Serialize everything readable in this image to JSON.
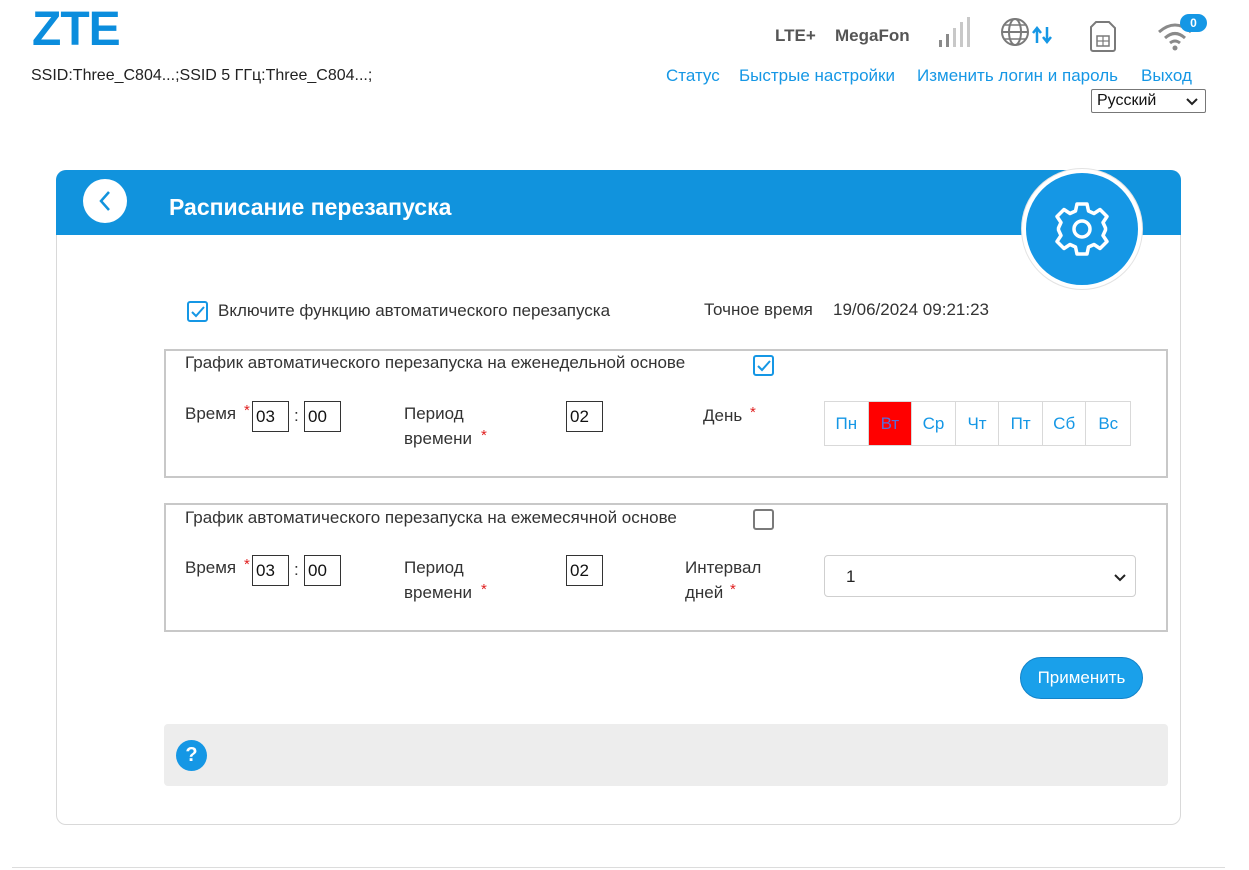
{
  "header": {
    "logo": "ZTE",
    "ssid_text": "SSID:Three_C804...;SSID 5 ГГц:Three_C804...;",
    "network_type": "LTE+",
    "operator": "MegaFon",
    "wifi_clients": "0",
    "icons": [
      "signal-icon",
      "globe-data-icon",
      "sim-icon",
      "wifi-icon"
    ]
  },
  "nav": {
    "status": "Статус",
    "quick_settings": "Быстрые настройки",
    "change_login": "Изменить логин и пароль",
    "exit": "Выход"
  },
  "language": {
    "selected": "Русский"
  },
  "page": {
    "title": "Расписание перезапуска",
    "enable_label": "Включите функцию автоматического перезапуска",
    "enable_checked": true,
    "exact_time_label": "Точное время",
    "exact_time_value": "19/06/2024 09:21:23"
  },
  "weekly": {
    "title": "График автоматического перезапуска на еженедельной основе",
    "checked": true,
    "time_label": "Время",
    "hour": "03",
    "minute": "00",
    "period_label_1": "Период",
    "period_label_2": "времени",
    "period_value": "02",
    "day_label": "День",
    "days": [
      "Пн",
      "Вт",
      "Ср",
      "Чт",
      "Пт",
      "Сб",
      "Вс"
    ],
    "active_day": "Вт"
  },
  "monthly": {
    "title": "График автоматического перезапуска на ежемесячной основе",
    "checked": false,
    "time_label": "Время",
    "hour": "03",
    "minute": "00",
    "period_label_1": "Период",
    "period_label_2": "времени",
    "period_value": "02",
    "interval_label_1": "Интервал",
    "interval_label_2": "дней",
    "interval_value": "1"
  },
  "actions": {
    "apply": "Применить"
  },
  "help": {
    "icon_text": "?"
  },
  "required_mark": "*",
  "colors": {
    "accent": "#1597e5",
    "header": "#1193dd",
    "active_day": "#ff0000"
  }
}
